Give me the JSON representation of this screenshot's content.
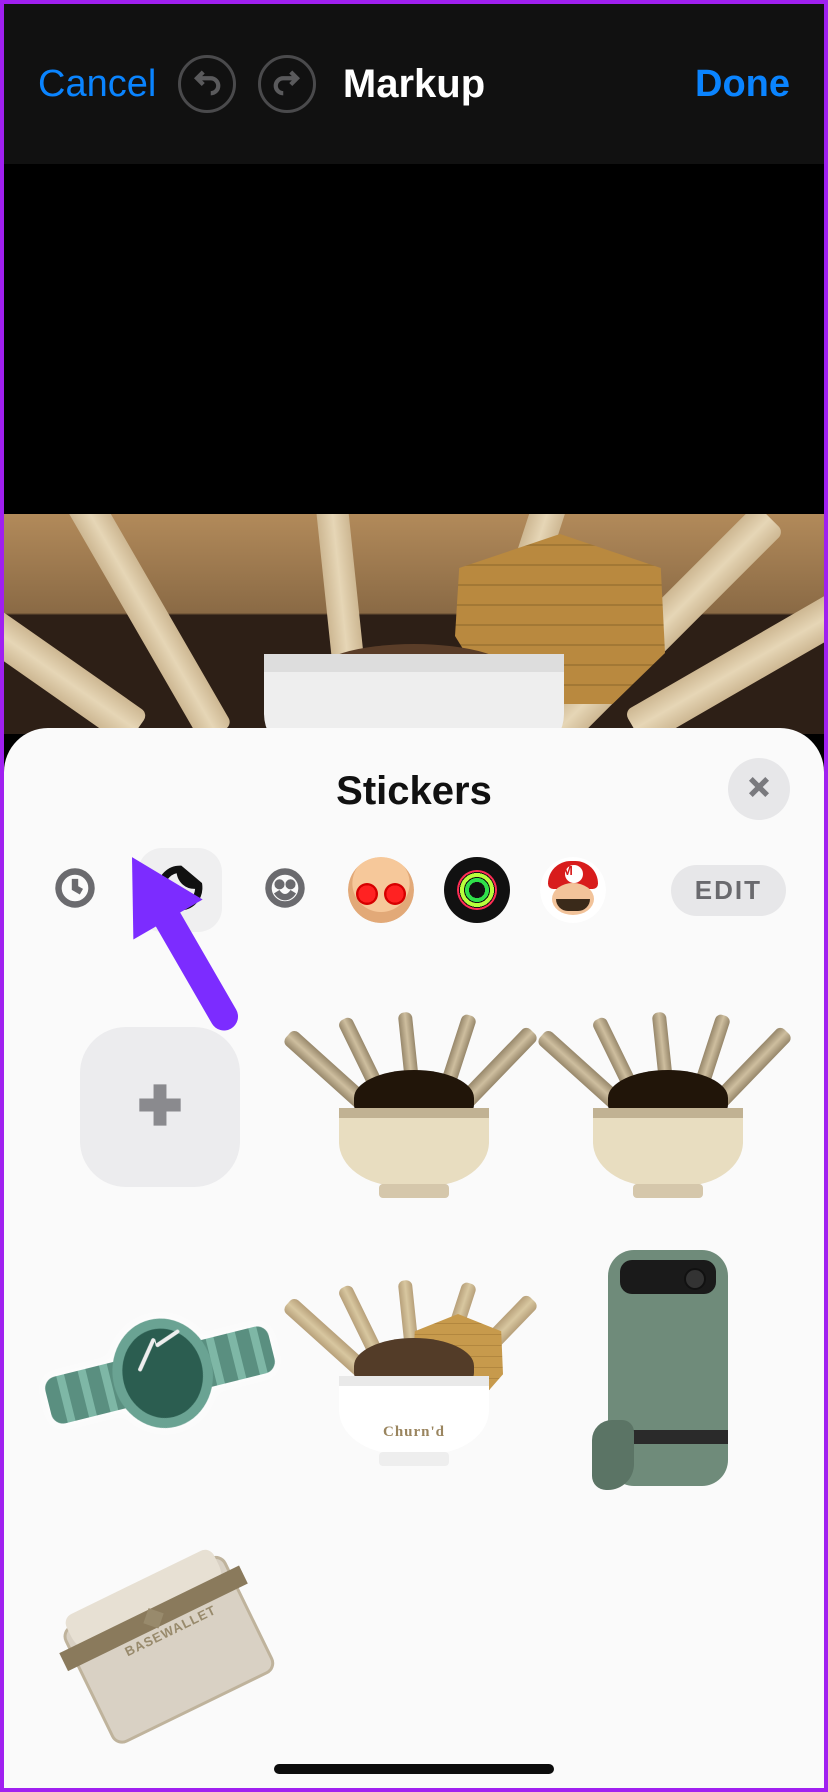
{
  "header": {
    "cancel": "Cancel",
    "title": "Markup",
    "done": "Done"
  },
  "sheet": {
    "title": "Stickers",
    "edit_label": "EDIT",
    "categories": [
      {
        "id": "recents",
        "icon": "clock-icon",
        "selected": false
      },
      {
        "id": "custom-stickers",
        "icon": "sticker-icon",
        "selected": true
      },
      {
        "id": "emoji",
        "icon": "smiley-icon",
        "selected": false
      },
      {
        "id": "memoji",
        "icon": "memoji-icon",
        "selected": false
      },
      {
        "id": "activity-rings",
        "icon": "rings-icon",
        "selected": false
      },
      {
        "id": "mario",
        "icon": "mario-icon",
        "selected": false
      }
    ],
    "stickers": [
      {
        "id": "add",
        "type": "add-button"
      },
      {
        "id": "ice-cream-comic-1",
        "type": "ice-cream-bowl",
        "style": "comic"
      },
      {
        "id": "ice-cream-comic-2",
        "type": "ice-cream-bowl",
        "style": "comic"
      },
      {
        "id": "wrist-watch",
        "type": "watch"
      },
      {
        "id": "ice-cream-photo",
        "type": "ice-cream-bowl",
        "style": "photo",
        "brand_text": "Churn'd"
      },
      {
        "id": "phone-back",
        "type": "phone"
      },
      {
        "id": "wallet",
        "type": "wallet",
        "brand_text": "BASEWALLET"
      }
    ]
  },
  "annotation": {
    "arrow_target": "custom-stickers-category"
  }
}
